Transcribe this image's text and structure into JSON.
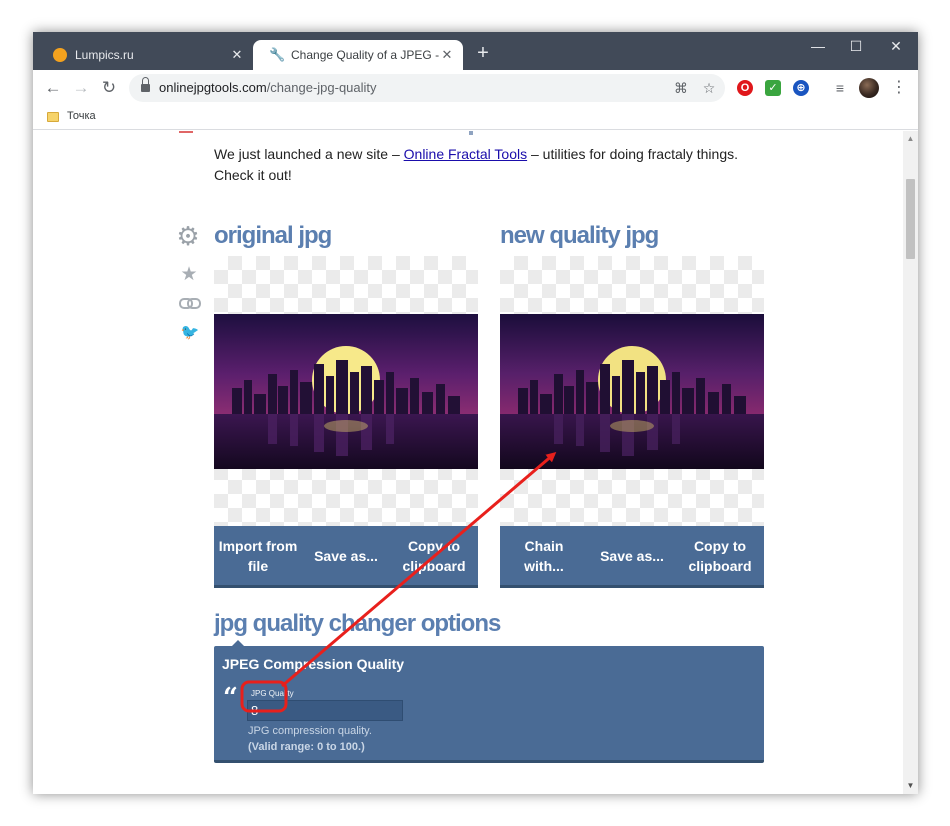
{
  "browser": {
    "tabs": [
      {
        "title": "Lumpics.ru",
        "close": "✕"
      },
      {
        "title": "Change Quality of a JPEG - Online",
        "close": "✕"
      }
    ],
    "new_tab": "+",
    "window_controls": {
      "minimize": "—",
      "maximize": "☐",
      "close": "✕"
    },
    "nav": {
      "back": "←",
      "forward": "→",
      "reload": "↻"
    },
    "url_domain": "onlinejpgtools.com",
    "url_path": "/change-jpg-quality",
    "bookmark": "Точка",
    "menu": "⋮"
  },
  "page": {
    "notice_before": "We just launched a new site – ",
    "notice_link": "Online Fractal Tools",
    "notice_after": " – utilities for doing fractaly things. Check it out!",
    "original_title": "original jpg",
    "new_title": "new quality jpg",
    "original_buttons": [
      {
        "label": "Import from file"
      },
      {
        "label": "Save as..."
      },
      {
        "label": "Copy to clipboard"
      }
    ],
    "new_buttons": [
      {
        "label": "Chain with..."
      },
      {
        "label": "Save as..."
      },
      {
        "label": "Copy to clipboard"
      }
    ],
    "options_title": "jpg quality changer options",
    "options": {
      "title": "JPEG Compression Quality",
      "input_label": "JPG Quality",
      "input_value": "8",
      "help_1": "JPG compression quality.",
      "help_2": "(Valid range: 0 to 100.)"
    }
  },
  "colors": {
    "accent": "#5b7fb0",
    "panel": "#4a6b95",
    "annotation": "#e8201c"
  }
}
